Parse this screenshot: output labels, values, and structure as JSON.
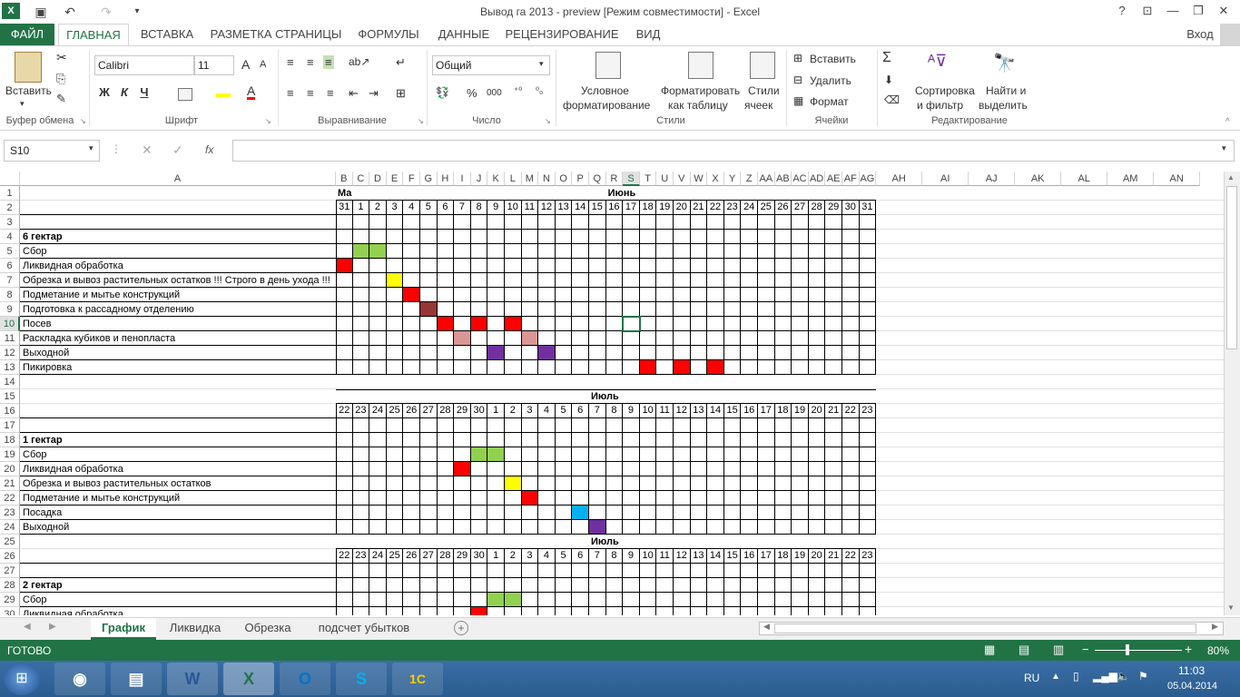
{
  "titlebar": {
    "title": "Вывод га 2013 - preview  [Режим совместимости] - Excel",
    "help": "?",
    "minimize": "—",
    "restore": "❐",
    "close": "✕"
  },
  "tabs": [
    {
      "label": "ФАЙЛ"
    },
    {
      "label": "ГЛАВНАЯ"
    },
    {
      "label": "ВСТАВКА"
    },
    {
      "label": "РАЗМЕТКА СТРАНИЦЫ"
    },
    {
      "label": "ФОРМУЛЫ"
    },
    {
      "label": "ДАННЫЕ"
    },
    {
      "label": "РЕЦЕНЗИРОВАНИЕ"
    },
    {
      "label": "ВИД"
    }
  ],
  "signin": "Вход",
  "ribbon": {
    "paste": "Вставить",
    "clipboard": "Буфер обмена",
    "font_name": "Calibri",
    "font_size": "11",
    "font_group": "Шрифт",
    "bold": "Ж",
    "italic": "К",
    "underline": "Ч",
    "align_group": "Выравнивание",
    "number_format": "Общий",
    "number_group": "Число",
    "cond_format": [
      "Условное",
      "форматирование"
    ],
    "format_table": [
      "Форматировать",
      "как таблицу"
    ],
    "cell_styles": [
      "Стили",
      "ячеек"
    ],
    "styles_group": "Стили",
    "insert": "Вставить",
    "delete": "Удалить",
    "format": "Формат",
    "cells_group": "Ячейки",
    "sort": [
      "Сортировка",
      "и фильтр"
    ],
    "find": [
      "Найти и",
      "выделить"
    ],
    "edit_group": "Редактирование"
  },
  "formula_bar": {
    "name_box": "S10",
    "fx": "fx",
    "value": ""
  },
  "columns": [
    "A",
    "B",
    "C",
    "D",
    "E",
    "F",
    "G",
    "H",
    "I",
    "J",
    "K",
    "L",
    "M",
    "N",
    "O",
    "P",
    "Q",
    "R",
    "S",
    "T",
    "U",
    "V",
    "W",
    "X",
    "Y",
    "Z",
    "AA",
    "AB",
    "AC",
    "AD",
    "AE",
    "AF",
    "AG",
    "AH",
    "AI",
    "AJ",
    "AK",
    "AL",
    "AM",
    "AN"
  ],
  "selected_cell": {
    "col": "S",
    "row": "10"
  },
  "rows": [
    {
      "n": "1",
      "a": "",
      "bold": false,
      "month": [
        {
          "col": 0,
          "text": "Ма"
        },
        {
          "col": 16,
          "text": "Июнь"
        }
      ]
    },
    {
      "n": "2",
      "a": "",
      "dates": [
        "31",
        "1",
        "2",
        "3",
        "4",
        "5",
        "6",
        "7",
        "8",
        "9",
        "10",
        "11",
        "12",
        "13",
        "14",
        "15",
        "16",
        "17",
        "18",
        "19",
        "20",
        "21",
        "22",
        "23",
        "24",
        "25",
        "26",
        "27",
        "28",
        "29",
        "30",
        "31"
      ]
    },
    {
      "n": "3",
      "a": ""
    },
    {
      "n": "4",
      "a": "6 гектар",
      "bold": true
    },
    {
      "n": "5",
      "a": "Сбор",
      "fills": [
        {
          "col": 1,
          "color": "#92d050"
        },
        {
          "col": 2,
          "color": "#92d050"
        }
      ]
    },
    {
      "n": "6",
      "a": "Ликвидная обработка",
      "fills": [
        {
          "col": 0,
          "color": "#ff0000"
        }
      ]
    },
    {
      "n": "7",
      "a": "Обрезка и вывоз растительных остатков !!! Строго в день ухода !!!",
      "fills": [
        {
          "col": 3,
          "color": "#ffff00"
        }
      ]
    },
    {
      "n": "8",
      "a": "Подметание и мытье конструкций",
      "fills": [
        {
          "col": 4,
          "color": "#ff0000"
        }
      ]
    },
    {
      "n": "9",
      "a": "Подготовка к рассадному отделению",
      "fills": [
        {
          "col": 5,
          "color": "#953735"
        }
      ]
    },
    {
      "n": "10",
      "a": "Посев",
      "fills": [
        {
          "col": 6,
          "color": "#ff0000"
        },
        {
          "col": 8,
          "color": "#ff0000"
        },
        {
          "col": 10,
          "color": "#ff0000"
        }
      ]
    },
    {
      "n": "11",
      "a": "Раскладка кубиков и пенопласта",
      "fills": [
        {
          "col": 7,
          "color": "#da9694"
        },
        {
          "col": 11,
          "color": "#da9694"
        }
      ]
    },
    {
      "n": "12",
      "a": "Выходной",
      "fills": [
        {
          "col": 9,
          "color": "#7030a0"
        },
        {
          "col": 12,
          "color": "#7030a0"
        }
      ]
    },
    {
      "n": "13",
      "a": "Пикировка",
      "fills": [
        {
          "col": 18,
          "color": "#ff0000"
        },
        {
          "col": 20,
          "color": "#ff0000"
        },
        {
          "col": 22,
          "color": "#ff0000"
        }
      ]
    },
    {
      "n": "14",
      "a": ""
    },
    {
      "n": "15",
      "a": "",
      "month": [
        {
          "col": 15,
          "text": "Июль"
        }
      ],
      "boxtop": true
    },
    {
      "n": "16",
      "a": "",
      "dates": [
        "22",
        "23",
        "24",
        "25",
        "26",
        "27",
        "28",
        "29",
        "30",
        "1",
        "2",
        "3",
        "4",
        "5",
        "6",
        "7",
        "8",
        "9",
        "10",
        "11",
        "12",
        "13",
        "14",
        "15",
        "16",
        "17",
        "18",
        "19",
        "20",
        "21",
        "22",
        "23"
      ]
    },
    {
      "n": "17",
      "a": ""
    },
    {
      "n": "18",
      "a": "1 гектар",
      "bold": true
    },
    {
      "n": "19",
      "a": "Сбор",
      "fills": [
        {
          "col": 8,
          "color": "#92d050"
        },
        {
          "col": 9,
          "color": "#92d050"
        }
      ]
    },
    {
      "n": "20",
      "a": "Ликвидная обработка",
      "fills": [
        {
          "col": 7,
          "color": "#ff0000"
        }
      ]
    },
    {
      "n": "21",
      "a": "Обрезка и вывоз растительных остатков",
      "fills": [
        {
          "col": 10,
          "color": "#ffff00"
        }
      ]
    },
    {
      "n": "22",
      "a": "Подметание и мытье конструкций",
      "fills": [
        {
          "col": 11,
          "color": "#ff0000"
        }
      ]
    },
    {
      "n": "23",
      "a": "Посадка",
      "fills": [
        {
          "col": 14,
          "color": "#00b0f0"
        }
      ]
    },
    {
      "n": "24",
      "a": "Выходной",
      "fills": [
        {
          "col": 15,
          "color": "#7030a0"
        }
      ]
    },
    {
      "n": "25",
      "a": "",
      "month": [
        {
          "col": 15,
          "text": "Июль"
        }
      ]
    },
    {
      "n": "26",
      "a": "",
      "dates": [
        "22",
        "23",
        "24",
        "25",
        "26",
        "27",
        "28",
        "29",
        "30",
        "1",
        "2",
        "3",
        "4",
        "5",
        "6",
        "7",
        "8",
        "9",
        "10",
        "11",
        "12",
        "13",
        "14",
        "15",
        "16",
        "17",
        "18",
        "19",
        "20",
        "21",
        "22",
        "23"
      ]
    },
    {
      "n": "27",
      "a": ""
    },
    {
      "n": "28",
      "a": "2 гектар",
      "bold": true
    },
    {
      "n": "29",
      "a": "Сбор",
      "fills": [
        {
          "col": 9,
          "color": "#92d050"
        },
        {
          "col": 10,
          "color": "#92d050"
        }
      ]
    },
    {
      "n": "30",
      "a": "Ликвидная обработка",
      "fills": [
        {
          "col": 8,
          "color": "#ff0000"
        }
      ]
    }
  ],
  "sheets": [
    {
      "label": "График",
      "active": true
    },
    {
      "label": "Ликвидка"
    },
    {
      "label": "Обрезка"
    },
    {
      "label": "подсчет убытков"
    }
  ],
  "status": {
    "ready": "ГОТОВО",
    "zoom": "80%"
  },
  "taskbar": {
    "lang": "RU",
    "time": "11:03",
    "date": "05.04.2014"
  }
}
